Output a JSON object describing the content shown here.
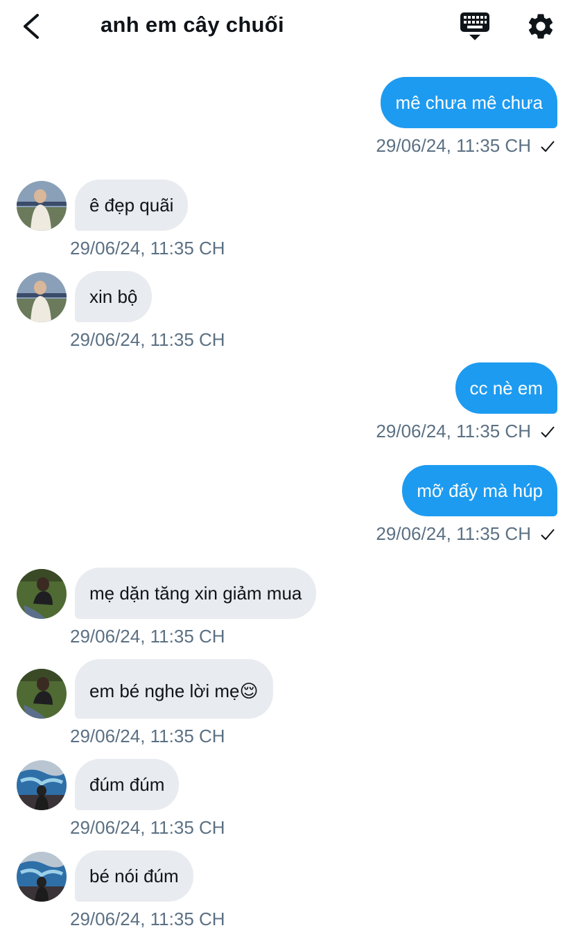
{
  "header": {
    "title": "anh em cây chuối",
    "back_icon": "chevron-left-icon",
    "keyboard_icon": "keyboard-icon",
    "settings_icon": "gear-icon"
  },
  "colors": {
    "outgoing_bubble": "#1d9bf0",
    "incoming_bubble": "#e8ebef",
    "timestamp": "#5b7083"
  },
  "messages": [
    {
      "direction": "out",
      "text": "mê chưa mê chưa",
      "time": "29/06/24, 11:35 CH"
    },
    {
      "direction": "in",
      "text": "ê đẹp quãi",
      "time": "29/06/24, 11:35 CH"
    },
    {
      "direction": "in",
      "text": "xin bộ",
      "time": "29/06/24, 11:35 CH"
    },
    {
      "direction": "out",
      "text": "cc nè em",
      "time": "29/06/24, 11:35 CH"
    },
    {
      "direction": "out",
      "text": "mỡ đấy mà húp",
      "time": "29/06/24, 11:35 CH"
    },
    {
      "direction": "in",
      "text": "mẹ dặn tăng xin giảm mua",
      "time": "29/06/24, 11:35 CH"
    },
    {
      "direction": "in",
      "text": "em bé nghe lời mẹ😌",
      "time": "29/06/24, 11:35 CH"
    },
    {
      "direction": "in",
      "text": "đúm đúm",
      "time": "29/06/24, 11:35 CH"
    },
    {
      "direction": "in",
      "text": "bé nói đúm",
      "time": "29/06/24, 11:35 CH"
    }
  ]
}
